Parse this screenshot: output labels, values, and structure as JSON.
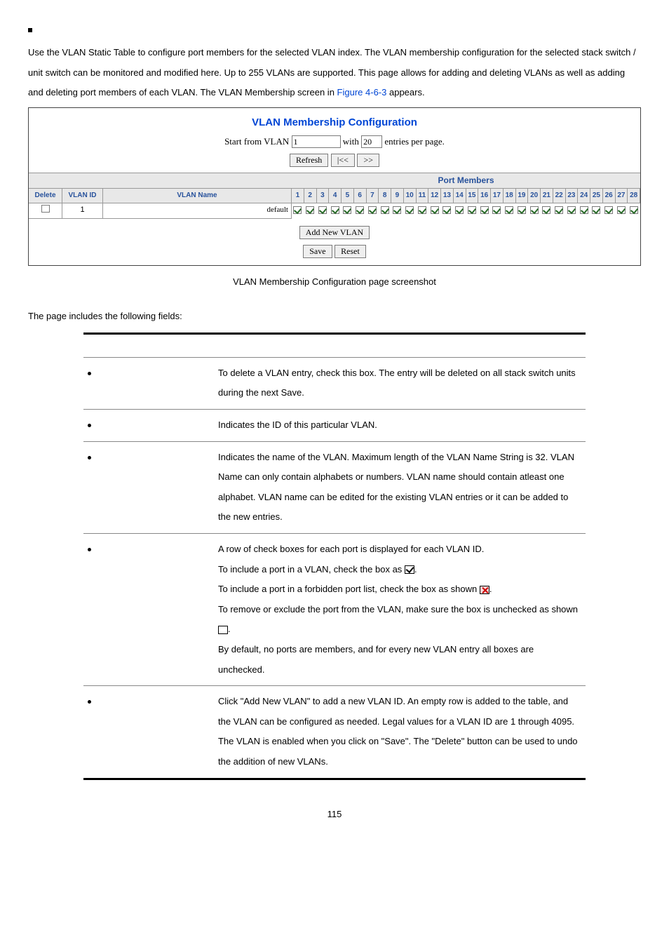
{
  "intro": {
    "text_before_link": "Use the VLAN Static Table to configure port members for the selected VLAN index. The VLAN membership configuration for the selected stack switch / unit switch can be monitored and modified here. Up to 255 VLANs are supported. This page allows for adding and deleting VLANs as well as adding and deleting port members of each VLAN. The VLAN Membership screen in ",
    "link": "Figure 4-6-3",
    "text_after_link": " appears."
  },
  "screenshot": {
    "title": "VLAN Membership Configuration",
    "start_label": "Start from VLAN",
    "start_value": "1",
    "with_label": "with",
    "with_value": "20",
    "entries_label": "entries per page.",
    "refresh": "Refresh",
    "prev": "|<<",
    "next": ">>",
    "port_members_header": "Port Members",
    "columns": {
      "delete": "Delete",
      "vlanid": "VLAN ID",
      "vlanname": "VLAN Name"
    },
    "row": {
      "vlanid": "1",
      "vlanname": "default"
    },
    "ports": [
      "1",
      "2",
      "3",
      "4",
      "5",
      "6",
      "7",
      "8",
      "9",
      "10",
      "11",
      "12",
      "13",
      "14",
      "15",
      "16",
      "17",
      "18",
      "19",
      "20",
      "21",
      "22",
      "23",
      "24",
      "25",
      "26",
      "27",
      "28"
    ],
    "add_new": "Add New VLAN",
    "save": "Save",
    "reset": "Reset"
  },
  "caption": "VLAN Membership Configuration page screenshot",
  "section_intro": "The page includes the following fields:",
  "fields": [
    {
      "desc": "To delete a VLAN entry, check this box.\nThe entry will be deleted on all stack switch units during the next Save."
    },
    {
      "desc": "Indicates the ID of this particular VLAN."
    },
    {
      "desc": "Indicates the name of the VLAN. Maximum length of the VLAN Name String is 32. VLAN Name can only contain alphabets or numbers. VLAN name should contain atleast one alphabet. VLAN name can be edited for the existing VLAN entries or it can be added to the new entries."
    },
    {
      "desc_parts": {
        "p1": "A row of check boxes for each port is displayed for each VLAN ID.",
        "p2_a": "To include a port in a VLAN, check the box as ",
        "p2_b": ".",
        "p3_a": "To include a port in a forbidden port list, check the box as shown ",
        "p3_b": ".",
        "p4_a": "To remove or exclude the port from the VLAN, make sure the box is unchecked as shown ",
        "p4_b": ".",
        "p5": "By default, no ports are members, and for every new VLAN entry all boxes are unchecked."
      }
    },
    {
      "desc": "Click \"Add New VLAN\" to add a new VLAN ID. An empty row is added to the table, and the VLAN can be configured as needed. Legal values for a VLAN ID are 1 through 4095.\nThe VLAN is enabled when you click on \"Save\". The \"Delete\" button can be used to undo the addition of new VLANs."
    }
  ],
  "page_number": "115"
}
